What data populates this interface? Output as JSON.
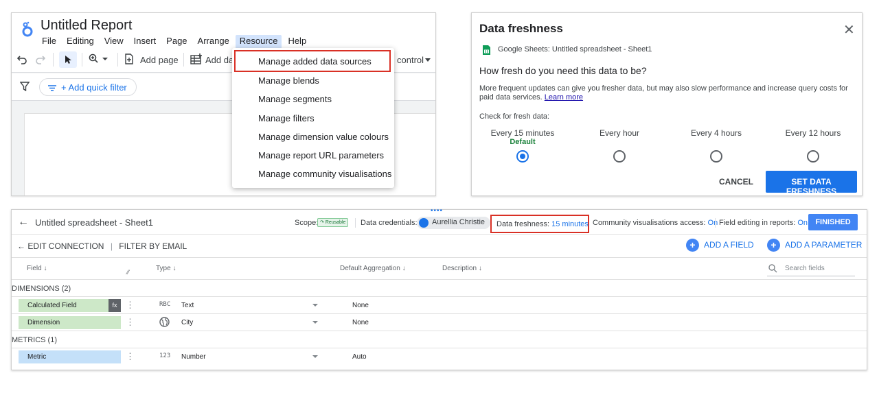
{
  "report": {
    "title": "Untitled Report",
    "menu": [
      "File",
      "Editing",
      "View",
      "Insert",
      "Page",
      "Arrange",
      "Resource",
      "Help"
    ],
    "active_menu": "Resource",
    "toolbar": {
      "add_page": "Add page",
      "add_data": "Add dat",
      "control": "control"
    },
    "quick_filter": "+ Add quick filter",
    "resource_menu": [
      "Manage added data sources",
      "Manage blends",
      "Manage segments",
      "Manage filters",
      "Manage dimension value colours",
      "Manage report URL parameters",
      "Manage community visualisations"
    ]
  },
  "dialog": {
    "title": "Data freshness",
    "source": "Google Sheets: Untitled spreadsheet - Sheet1",
    "question": "How fresh do you need this data to be?",
    "description": "More frequent updates can give you fresher data, but may also slow performance and increase query costs for paid data services.",
    "learn_more": "Learn more",
    "check_label": "Check for fresh data:",
    "options": [
      "Every 15 minutes",
      "Every hour",
      "Every 4 hours",
      "Every 12 hours"
    ],
    "default_label": "Default",
    "selected_index": 0,
    "cancel": "CANCEL",
    "confirm": "SET DATA FRESHNESS"
  },
  "datasource": {
    "name": "Untitled spreadsheet - Sheet1",
    "scope_label": "Scope:",
    "scope_badge": "Reusable",
    "credentials_label": "Data credentials:",
    "credentials_user": "Aurellia Christie",
    "freshness_label": "Data freshness:",
    "freshness_value": "15 minutes",
    "community_label": "Community visualisations access:",
    "community_value": "On",
    "field_editing_label": "Field editing in reports:",
    "field_editing_value": "On",
    "finished": "FINISHED",
    "edit_connection": "EDIT CONNECTION",
    "filter_by_email": "FILTER BY EMAIL",
    "add_field": "ADD A FIELD",
    "add_parameter": "ADD A PARAMETER",
    "columns": {
      "field": "Field",
      "type": "Type",
      "aggregation": "Default Aggregation",
      "description": "Description"
    },
    "search_placeholder": "Search fields",
    "dimensions_header": "DIMENSIONS (2)",
    "metrics_header": "METRICS (1)",
    "fields": [
      {
        "name": "Calculated Field",
        "type_icon": "RBC",
        "type": "Text",
        "aggregation": "None",
        "color": "#cde8c8"
      },
      {
        "name": "Dimension",
        "type_icon": "globe",
        "type": "City",
        "aggregation": "None",
        "color": "#cde8c8"
      },
      {
        "name": "Metric",
        "type_icon": "123",
        "type": "Number",
        "aggregation": "Auto",
        "color": "#c4e0f9"
      }
    ]
  }
}
